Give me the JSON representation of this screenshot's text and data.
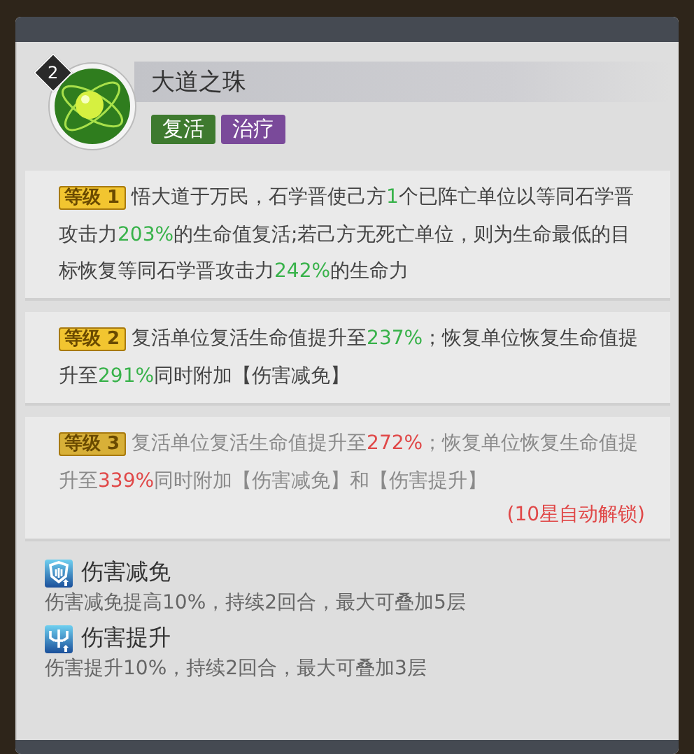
{
  "skill": {
    "rank": "2",
    "name": "大道之珠",
    "tags": [
      {
        "label": "复活",
        "color": "#3e7a2f"
      },
      {
        "label": "治疗",
        "color": "#7a4a9a"
      }
    ]
  },
  "levels": [
    {
      "badge": "等级",
      "number": "1",
      "locked": false,
      "segments": [
        {
          "text": "悟大道于万民，石学晋使己方",
          "highlight": false
        },
        {
          "text": "1",
          "highlight": true
        },
        {
          "text": "个已阵亡单位以等同石学晋攻击力",
          "highlight": false
        },
        {
          "text": "203%",
          "highlight": true
        },
        {
          "text": "的生命值复活;若己方无死亡单位，则为生命最低的目标恢复等同石学晋攻击力",
          "highlight": false
        },
        {
          "text": "242%",
          "highlight": true
        },
        {
          "text": "的生命力",
          "highlight": false
        }
      ]
    },
    {
      "badge": "等级",
      "number": "2",
      "locked": false,
      "segments": [
        {
          "text": "复活单位复活生命值提升至",
          "highlight": false
        },
        {
          "text": "237%",
          "highlight": true
        },
        {
          "text": "；恢复单位恢复生命值提升至",
          "highlight": false
        },
        {
          "text": "291%",
          "highlight": true
        },
        {
          "text": "同时附加【伤害减免】",
          "highlight": false
        }
      ]
    },
    {
      "badge": "等级",
      "number": "3",
      "locked": true,
      "unlock_note": "(10星自动解锁)",
      "segments": [
        {
          "text": "复活单位复活生命值提升至",
          "highlight": false
        },
        {
          "text": "272%",
          "highlight": true
        },
        {
          "text": "；恢复单位恢复生命值提升至",
          "highlight": false
        },
        {
          "text": "339%",
          "highlight": true
        },
        {
          "text": "同时附加【伤害减免】和【伤害提升】",
          "highlight": false
        }
      ]
    }
  ],
  "effects": [
    {
      "name": "伤害减免",
      "description": "伤害减免提高10%，持续2回合，最大可叠加5层",
      "kind": "shield"
    },
    {
      "name": "伤害提升",
      "description": "伤害提升10%，持续2回合，最大可叠加3层",
      "kind": "sword"
    }
  ]
}
